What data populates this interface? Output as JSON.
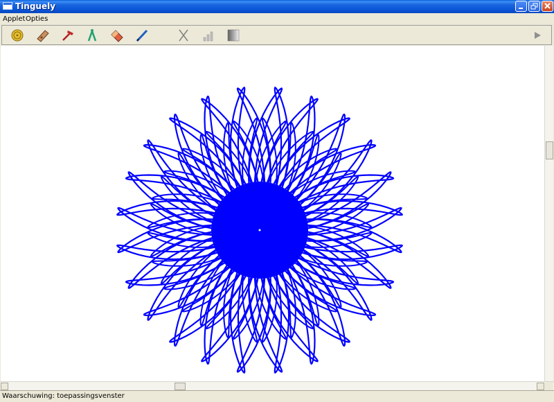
{
  "window": {
    "title": "Tinguely"
  },
  "menu": {
    "items": [
      {
        "label": "Applet"
      },
      {
        "label": "Opties"
      }
    ]
  },
  "toolbar": {
    "tools": [
      {
        "icon": "gear-wheel-icon"
      },
      {
        "icon": "wooden-block-icon"
      },
      {
        "icon": "hammer-icon"
      },
      {
        "icon": "compass-icon"
      },
      {
        "icon": "eraser-icon"
      },
      {
        "icon": "pen-icon"
      },
      {
        "icon": "scissors-icon"
      },
      {
        "icon": "bars-icon"
      },
      {
        "icon": "gradient-icon"
      },
      {
        "icon": "play-icon"
      }
    ]
  },
  "drawing": {
    "description_shape": "spirograph rosette",
    "color": "#0000ff",
    "outer_lobes": 48
  },
  "colors": {
    "titlebar": "#0a5fd8",
    "window_bg": "#ece9d8",
    "canvas_bg": "#ffffff",
    "close_button": "#c8441c"
  },
  "status": {
    "text": "Waarschuwing: toepassingsvenster"
  }
}
